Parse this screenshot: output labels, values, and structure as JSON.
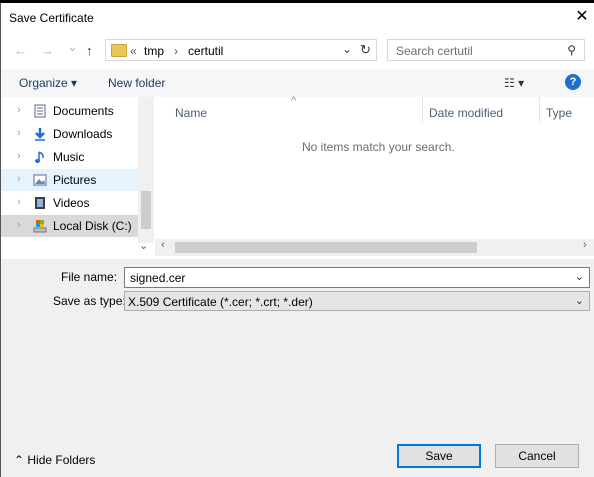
{
  "window": {
    "title": "Save Certificate",
    "close_glyph": "✕"
  },
  "nav": {
    "back_glyph": "←",
    "forward_glyph": "→",
    "recent_glyph": "⌄",
    "up_glyph": "↑",
    "breadcrumb": {
      "overflow": "«",
      "separator": "›",
      "items": [
        "tmp",
        "certutil"
      ]
    },
    "dropdown_glyph": "⌄",
    "refresh_glyph": "↻"
  },
  "search": {
    "placeholder": "Search certutil",
    "icon_glyph": "⚲"
  },
  "toolbar": {
    "organize_label": "Organize ▾",
    "new_folder_label": "New folder",
    "view_glyph": "☷ ▾",
    "help_glyph": "?"
  },
  "sidebar": {
    "items": [
      {
        "label": "Documents",
        "icon": "document-icon",
        "chevron": "›"
      },
      {
        "label": "Downloads",
        "icon": "download-icon",
        "chevron": "›"
      },
      {
        "label": "Music",
        "icon": "music-icon",
        "chevron": "›"
      },
      {
        "label": "Pictures",
        "icon": "picture-icon",
        "chevron": "›"
      },
      {
        "label": "Videos",
        "icon": "video-icon",
        "chevron": "›"
      },
      {
        "label": "Local Disk (C:)",
        "icon": "drive-icon",
        "chevron": "›"
      }
    ],
    "scroll_down_glyph": "⌄"
  },
  "files": {
    "columns": [
      "Name",
      "Date modified",
      "Type"
    ],
    "sort_glyph": "^",
    "empty_message": "No items match your search.",
    "scroll_left": "‹",
    "scroll_right": "›"
  },
  "form": {
    "file_name_label": "File name:",
    "file_name_value": "signed.cer",
    "save_type_label": "Save as type:",
    "save_type_value": "X.509 Certificate (*.cer; *.crt; *.der)",
    "caret": "⌄"
  },
  "footer": {
    "hide_folders_label": "⌃  Hide Folders",
    "save_label": "Save",
    "cancel_label": "Cancel"
  },
  "colors": {
    "accent": "#0078d7",
    "selected_row": "#cce8ff",
    "hover_row": "#e5f3ff"
  }
}
